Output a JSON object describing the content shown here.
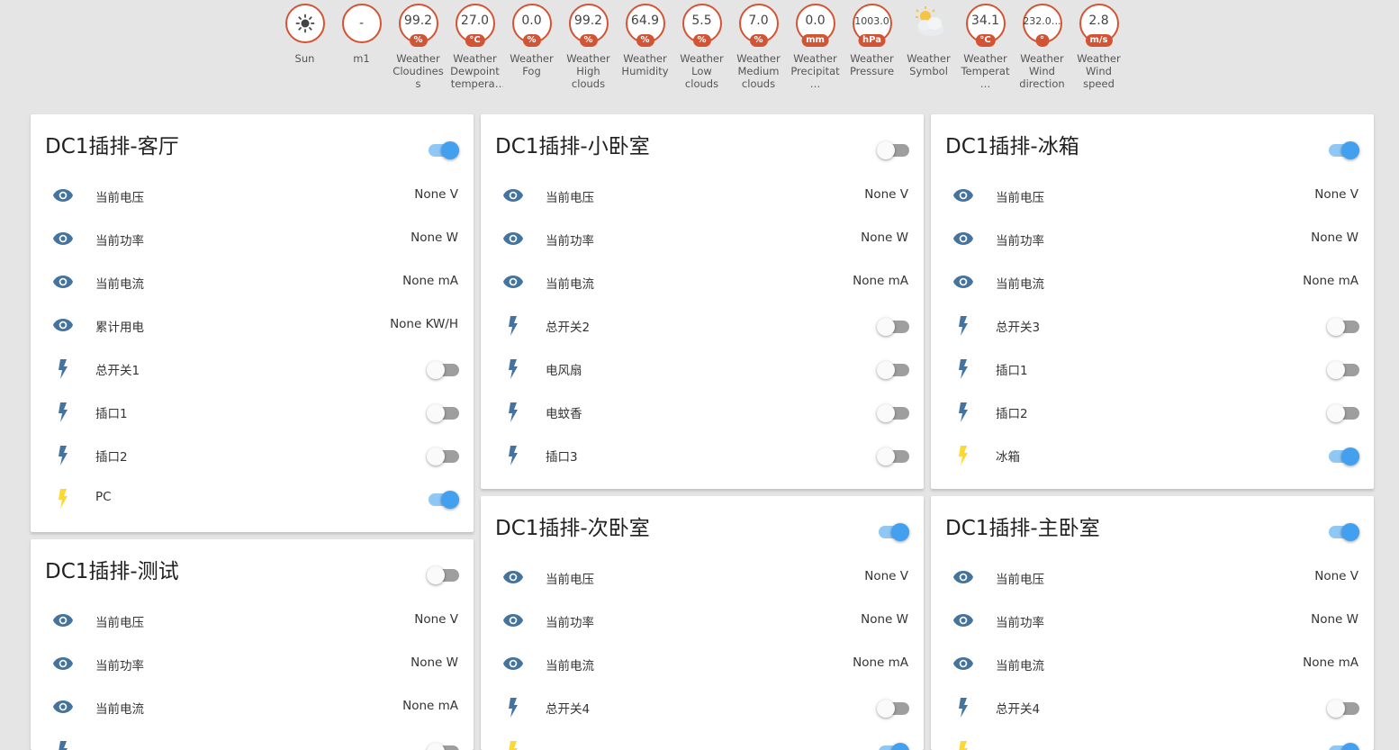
{
  "colors": {
    "badge_border": "#d25434",
    "toggle_on": "#43a0ef",
    "toggle_on_track": "#8fc7f5",
    "icon_off": "#44739e",
    "icon_on": "#fdd835"
  },
  "badges": [
    {
      "name": "sun",
      "value": "",
      "icon": "sun-icon",
      "unit": "",
      "label": "Sun"
    },
    {
      "name": "m1",
      "value": "-",
      "unit": "",
      "label": "m1"
    },
    {
      "name": "cloudiness",
      "value": "99.2",
      "unit": "%",
      "label": "Weather Cloudiness"
    },
    {
      "name": "dewpoint",
      "value": "27.0",
      "unit": "°C",
      "label": "Weather Dewpoint temperat…"
    },
    {
      "name": "fog",
      "value": "0.0",
      "unit": "%",
      "label": "Weather Fog"
    },
    {
      "name": "high-clouds",
      "value": "99.2",
      "unit": "%",
      "label": "Weather High clouds"
    },
    {
      "name": "humidity",
      "value": "64.9",
      "unit": "%",
      "label": "Weather Humidity"
    },
    {
      "name": "low-clouds",
      "value": "5.5",
      "unit": "%",
      "label": "Weather Low clouds"
    },
    {
      "name": "medium-clouds",
      "value": "7.0",
      "unit": "%",
      "label": "Weather Medium clouds"
    },
    {
      "name": "precipitation",
      "value": "0.0",
      "unit": "mm",
      "label": "Weather Precipitat…"
    },
    {
      "name": "pressure",
      "value": "1003.0",
      "unit": "hPa",
      "label": "Weather Pressure"
    },
    {
      "name": "symbol",
      "value": "",
      "icon": "partly-cloudy-icon",
      "unit": "",
      "label": "Weather Symbol"
    },
    {
      "name": "temperature",
      "value": "34.1",
      "unit": "°C",
      "label": "Weather Temperat…"
    },
    {
      "name": "wind-direction",
      "value": "232.0…",
      "unit": "°",
      "label": "Weather Wind direction"
    },
    {
      "name": "wind-speed",
      "value": "2.8",
      "unit": "m/s",
      "label": "Weather Wind speed"
    }
  ],
  "cards": [
    {
      "id": "keting",
      "title": "DC1插排-客厅",
      "toggle_on": true,
      "rows": [
        {
          "type": "sensor",
          "icon": "eye-icon",
          "label": "当前电压",
          "value": "None V"
        },
        {
          "type": "sensor",
          "icon": "eye-icon",
          "label": "当前功率",
          "value": "None W"
        },
        {
          "type": "sensor",
          "icon": "eye-icon",
          "label": "当前电流",
          "value": "None mA"
        },
        {
          "type": "sensor",
          "icon": "eye-icon",
          "label": "累计用电",
          "value": "None KW/H"
        },
        {
          "type": "switch",
          "icon": "flash-icon",
          "label": "总开关1",
          "on": false
        },
        {
          "type": "switch",
          "icon": "flash-icon",
          "label": "插口1",
          "on": false
        },
        {
          "type": "switch",
          "icon": "flash-icon",
          "label": "插口2",
          "on": false
        },
        {
          "type": "switch",
          "icon": "flash-icon",
          "label": "PC",
          "on": true
        }
      ]
    },
    {
      "id": "xiaowoshi",
      "title": "DC1插排-小卧室",
      "toggle_on": false,
      "rows": [
        {
          "type": "sensor",
          "icon": "eye-icon",
          "label": "当前电压",
          "value": "None V"
        },
        {
          "type": "sensor",
          "icon": "eye-icon",
          "label": "当前功率",
          "value": "None W"
        },
        {
          "type": "sensor",
          "icon": "eye-icon",
          "label": "当前电流",
          "value": "None mA"
        },
        {
          "type": "switch",
          "icon": "flash-icon",
          "label": "总开关2",
          "on": false
        },
        {
          "type": "switch",
          "icon": "flash-icon",
          "label": "电风扇",
          "on": false
        },
        {
          "type": "switch",
          "icon": "flash-icon",
          "label": "电蚊香",
          "on": false
        },
        {
          "type": "switch",
          "icon": "flash-icon",
          "label": "插口3",
          "on": false
        }
      ]
    },
    {
      "id": "bingxiang",
      "title": "DC1插排-冰箱",
      "toggle_on": true,
      "rows": [
        {
          "type": "sensor",
          "icon": "eye-icon",
          "label": "当前电压",
          "value": "None V"
        },
        {
          "type": "sensor",
          "icon": "eye-icon",
          "label": "当前功率",
          "value": "None W"
        },
        {
          "type": "sensor",
          "icon": "eye-icon",
          "label": "当前电流",
          "value": "None mA"
        },
        {
          "type": "switch",
          "icon": "flash-icon",
          "label": "总开关3",
          "on": false
        },
        {
          "type": "switch",
          "icon": "flash-icon",
          "label": "插口1",
          "on": false
        },
        {
          "type": "switch",
          "icon": "flash-icon",
          "label": "插口2",
          "on": false
        },
        {
          "type": "switch",
          "icon": "flash-icon",
          "label": "冰箱",
          "on": true
        }
      ]
    },
    {
      "id": "ceshi",
      "title": "DC1插排-测试",
      "toggle_on": false,
      "rows": [
        {
          "type": "sensor",
          "icon": "eye-icon",
          "label": "当前电压",
          "value": "None V"
        },
        {
          "type": "sensor",
          "icon": "eye-icon",
          "label": "当前功率",
          "value": "None W"
        },
        {
          "type": "sensor",
          "icon": "eye-icon",
          "label": "当前电流",
          "value": "None mA"
        },
        {
          "type": "switch",
          "icon": "flash-icon",
          "label": "",
          "on": false
        }
      ]
    },
    {
      "id": "ciwoshi",
      "title": "DC1插排-次卧室",
      "toggle_on": true,
      "rows": [
        {
          "type": "sensor",
          "icon": "eye-icon",
          "label": "当前电压",
          "value": "None V"
        },
        {
          "type": "sensor",
          "icon": "eye-icon",
          "label": "当前功率",
          "value": "None W"
        },
        {
          "type": "sensor",
          "icon": "eye-icon",
          "label": "当前电流",
          "value": "None mA"
        },
        {
          "type": "switch",
          "icon": "flash-icon",
          "label": "总开关4",
          "on": false
        },
        {
          "type": "switch",
          "icon": "flash-icon",
          "label": "",
          "on": true
        }
      ]
    },
    {
      "id": "zhuwoshi",
      "title": "DC1插排-主卧室",
      "toggle_on": true,
      "rows": [
        {
          "type": "sensor",
          "icon": "eye-icon",
          "label": "当前电压",
          "value": "None V"
        },
        {
          "type": "sensor",
          "icon": "eye-icon",
          "label": "当前功率",
          "value": "None W"
        },
        {
          "type": "sensor",
          "icon": "eye-icon",
          "label": "当前电流",
          "value": "None mA"
        },
        {
          "type": "switch",
          "icon": "flash-icon",
          "label": "总开关4",
          "on": false
        },
        {
          "type": "switch",
          "icon": "flash-icon",
          "label": "",
          "on": true
        }
      ]
    }
  ]
}
